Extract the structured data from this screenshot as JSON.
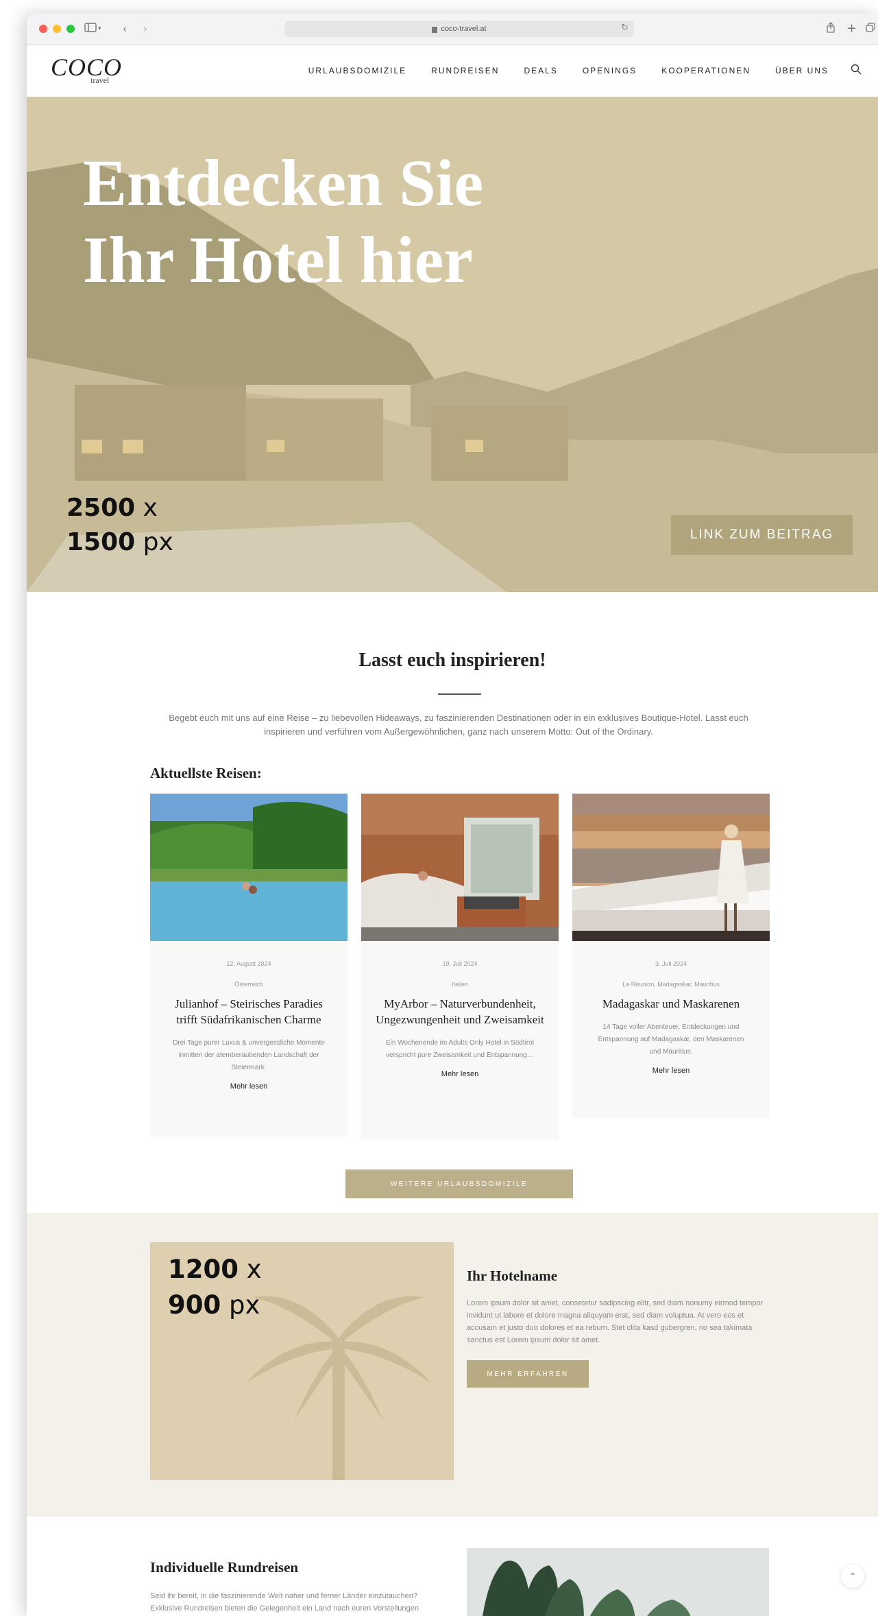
{
  "browser": {
    "url": "coco-travel.at"
  },
  "nav": {
    "logo": "COCO",
    "logo_sub": "travel",
    "items": [
      {
        "label": "URLAUBSDOMIZILE"
      },
      {
        "label": "RUNDREISEN"
      },
      {
        "label": "DEALS"
      },
      {
        "label": "OPENINGS"
      },
      {
        "label": "KOOPERATIONEN"
      },
      {
        "label": "ÜBER UNS"
      }
    ]
  },
  "hero": {
    "title": "Entdecken Sie\nIhr Hotel hier",
    "dim_w": "2500",
    "dim_h": "1500",
    "dim_x": "x",
    "dim_unit": "px",
    "button": "LINK ZUM BEITRAG"
  },
  "inspire": {
    "title": "Lasst euch inspirieren!",
    "intro": "Begebt euch mit uns auf eine Reise – zu liebevollen Hideaways, zu faszinierenden Destinationen oder in ein exklusives Boutique-Hotel. Lasst euch inspirieren und verführen vom Außergewöhnlichen, ganz nach unserem Motto: Out of the Ordinary.",
    "recent_heading": "Aktuellste Reisen:",
    "cards": [
      {
        "date": "12. August 2024",
        "location": "Österreich",
        "title": "Julianhof – Steirisches Paradies trifft Südafrikanischen Charme",
        "desc": "Drei Tage purer Luxus & unvergessliche Momente inmitten der atemberaubenden Landschaft der Steiermark.",
        "more": "Mehr lesen"
      },
      {
        "date": "19. Juli 2024",
        "location": "Italien",
        "title": "MyArbor – Naturverbundenheit, Ungezwungenheit und Zweisamkeit",
        "desc": "Ein Wochenende im Adults Only Hotel in Südtirol verspricht pure Zweisamkeit und Entspannung…",
        "more": "Mehr lesen"
      },
      {
        "date": "3. Juli 2024",
        "location": "La Réunion, Madagaskar, Mauritius",
        "title": "Madagaskar und Maskarenen",
        "desc": "14 Tage voller Abenteuer, Entdeckungen und Entspannung auf Madagaskar, den Maskarenen und Mauritius.",
        "more": "Mehr lesen"
      }
    ],
    "more_button": "WEITERE URLAUBSDOMIZILE"
  },
  "hotel": {
    "dim_w": "1200",
    "dim_h": "900",
    "dim_x": "x",
    "dim_unit": "px",
    "name": "Ihr Hotelname",
    "desc": "Lorem ipsum dolor sit amet, consetetur sadipscing elitr, sed diam nonumy eirmod tempor invidunt ut labore et dolore magna aliquyam erat, sed diam voluptua. At vero eos et accusam et justo duo dolores et ea rebum. Stet clita kasd gubergren, no sea takimata sanctus est Lorem ipsum dolor sit amet.",
    "button": "MEHR ERFAHREN"
  },
  "rundreisen": {
    "title": "Individuelle Rundreisen",
    "text": "Seid ihr bereit, in die faszinierende Welt naher und ferner Länder einzutauchen? Exklusive Rundreisen bieten die Gelegenheit ein Land nach euren Vorstellungen"
  },
  "colors": {
    "accent": "#b8ab82",
    "hero_overlay": "#cdbf9c",
    "section_bg": "#f3f1e9"
  },
  "icons": [
    "search-icon",
    "sidebar-icon",
    "back-icon",
    "forward-icon",
    "share-icon",
    "new-tab-icon",
    "tabs-icon",
    "lock-icon",
    "reload-icon",
    "palm-tree-icon",
    "chevron-up-icon"
  ]
}
